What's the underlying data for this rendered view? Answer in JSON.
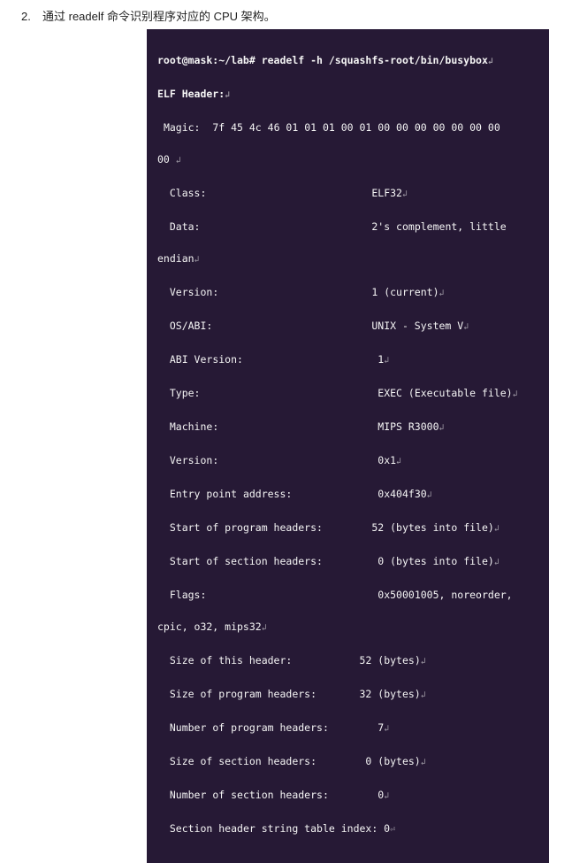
{
  "list_number": "2.",
  "instruction": "通过 readelf 命令识别程序对应的 CPU 架构。",
  "terminal": {
    "prompt": "root@mask:~/lab# readelf -h /squashfs-root/bin/busybox",
    "nl": "↲",
    "elf_header_label": "ELF Header:",
    "magic_label": "Magic:",
    "magic_value": "7f 45 4c 46 01 01 01 00 01 00 00 00 00 00 00 00",
    "magic_tail": "00",
    "fields": {
      "class": {
        "label": "Class:",
        "value": "ELF32"
      },
      "data": {
        "label": "Data:",
        "value": "2's complement, little"
      },
      "endian_tail": {
        "label": "endian"
      },
      "version": {
        "label": "Version:",
        "value": "1 (current)"
      },
      "osabi": {
        "label": "OS/ABI:",
        "value": "UNIX - System V"
      },
      "abi_version": {
        "label": "ABI Version:",
        "value": "1"
      },
      "type": {
        "label": "Type:",
        "value": "EXEC (Executable file)"
      },
      "machine": {
        "label": "Machine:",
        "value": "MIPS R3000"
      },
      "version_hex": {
        "label": "Version:",
        "value": "0x1"
      },
      "entry": {
        "label": "Entry point address:",
        "value": "0x404f30"
      },
      "ph_start": {
        "label": "Start of program headers:",
        "value": "52 (bytes into file)"
      },
      "sh_start": {
        "label": "Start of section headers:",
        "value": "0 (bytes into file)"
      },
      "flags": {
        "label": "Flags:",
        "value": "0x50001005, noreorder,"
      },
      "flags_tail": {
        "label": "cpic, o32, mips32"
      },
      "hdr_size": {
        "label": "Size of this header:",
        "value": "52 (bytes)"
      },
      "ph_size": {
        "label": "Size of program headers:",
        "value": "32 (bytes)"
      },
      "ph_num": {
        "label": "Number of program headers:",
        "value": "7"
      },
      "sh_size": {
        "label": "Size of section headers:",
        "value": "0 (bytes)"
      },
      "sh_num": {
        "label": "Number of section headers:",
        "value": "0"
      },
      "shstrndx": {
        "label": "Section header string table index: 0"
      }
    }
  }
}
